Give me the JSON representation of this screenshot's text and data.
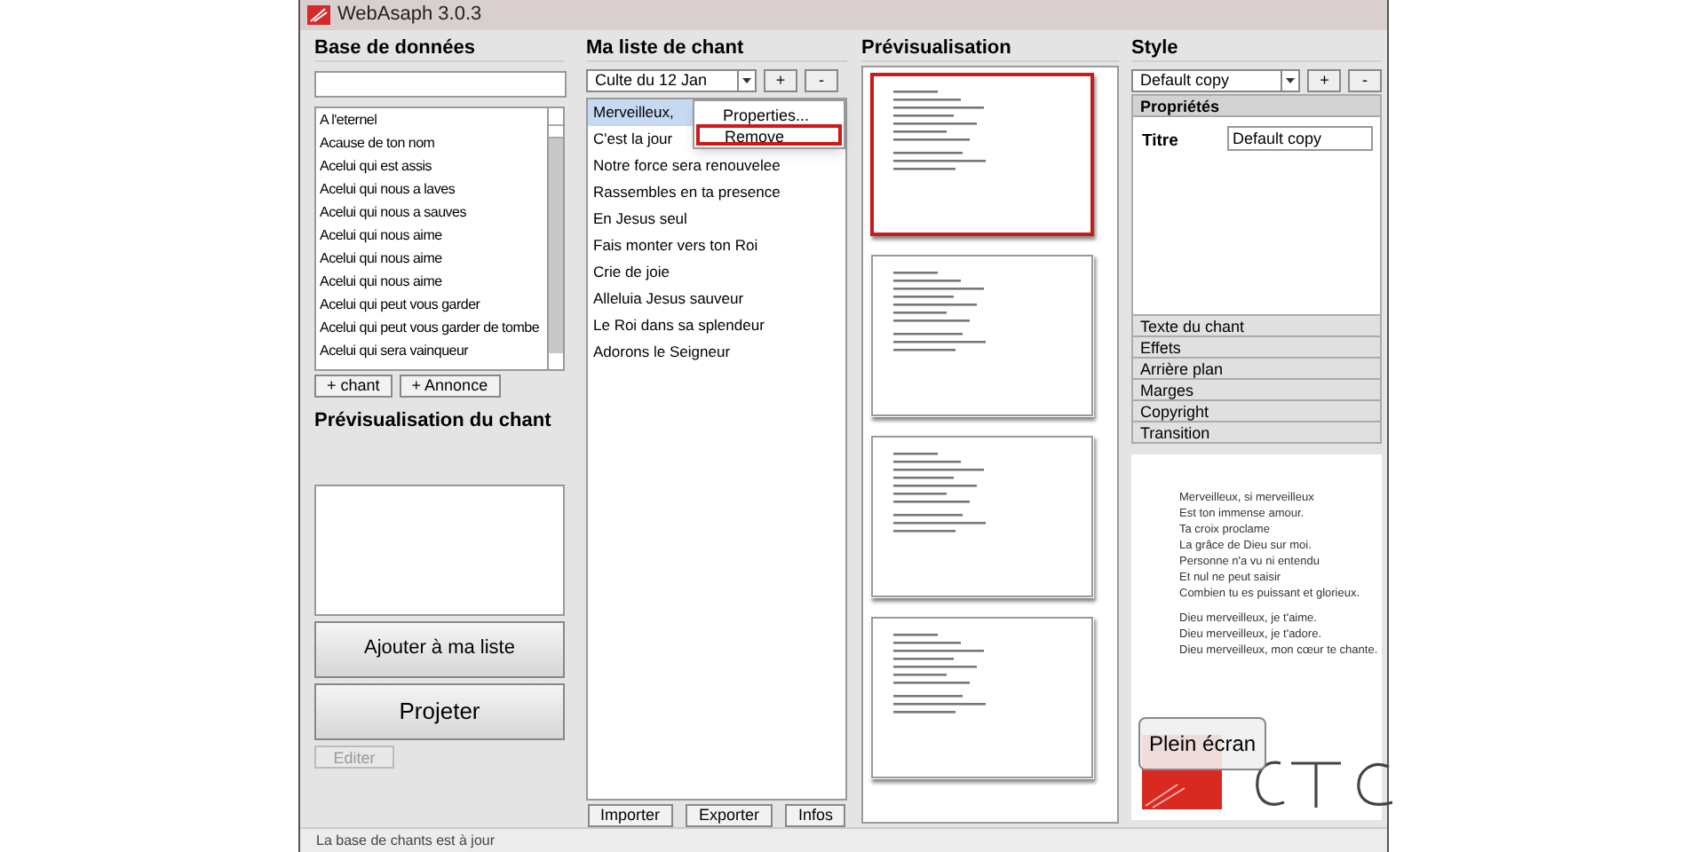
{
  "window": {
    "title": "WebAsaph 3.0.3"
  },
  "database": {
    "heading": "Base de données",
    "songs": [
      "A l'eternel",
      "Acause de ton nom",
      "Acelui qui est assis",
      "Acelui qui nous a laves",
      "Acelui qui nous a sauves",
      "Acelui qui nous aime",
      "Acelui qui nous aime",
      "Acelui qui nous aime",
      "Acelui qui peut vous garder",
      "Acelui qui peut vous garder de tombe",
      "Acelui qui sera vainqueur"
    ],
    "buttons": [
      "+ chant",
      "+ Annonce"
    ]
  },
  "song_preview": {
    "heading": "Prévisualisation du chant",
    "add_button": "Ajouter à ma liste",
    "project_button": "Projeter",
    "edit_button": {
      "label": "Editer",
      "disabled": true
    }
  },
  "my_list": {
    "heading": "Ma liste de chant",
    "playlist": "Culte du 12 Jan",
    "add": "+",
    "remove": "-",
    "items": [
      {
        "title": "Merveilleux,",
        "selected": true
      },
      {
        "title": "C'est la jour",
        "selected": false
      },
      {
        "title": "Notre force sera renouvelee",
        "selected": false
      },
      {
        "title": "Rassembles en ta presence",
        "selected": false
      },
      {
        "title": "En Jesus seul",
        "selected": false
      },
      {
        "title": "Fais monter vers ton Roi",
        "selected": false
      },
      {
        "title": "Crie de joie",
        "selected": false
      },
      {
        "title": "Alleluia Jesus sauveur",
        "selected": false
      },
      {
        "title": "Le Roi dans sa splendeur",
        "selected": false
      },
      {
        "title": "Adorons le Seigneur",
        "selected": false
      }
    ],
    "context_menu": [
      {
        "label": "Properties...",
        "highlighted": false
      },
      {
        "label": "Remove",
        "highlighted": true
      }
    ],
    "buttons": [
      "Importer",
      "Exporter",
      "Infos"
    ]
  },
  "preview": {
    "heading": "Prévisualisation",
    "slides": [
      {
        "selected": true
      },
      {
        "selected": false
      },
      {
        "selected": false
      },
      {
        "selected": false
      }
    ]
  },
  "style": {
    "heading": "Style",
    "style_name": "Default copy",
    "add": "+",
    "remove": "-",
    "sections": [
      {
        "title": "Propriétés",
        "expanded": true
      },
      {
        "title": "Texte du chant",
        "expanded": false
      },
      {
        "title": "Effets",
        "expanded": false
      },
      {
        "title": "Arrière plan",
        "expanded": false
      },
      {
        "title": "Marges",
        "expanded": false
      },
      {
        "title": "Copyright",
        "expanded": false
      },
      {
        "title": "Transition",
        "expanded": false
      }
    ],
    "title_label": "Titre",
    "title_value": "Default copy",
    "lyrics": [
      [
        "Merveilleux, si merveilleux",
        "Est ton immense amour.",
        "Ta croix proclame",
        "La grâce de Dieu sur moi.",
        "Personne n'a vu ni entendu",
        "Et nul ne peut saisir",
        "Combien tu es puissant et glorieux."
      ],
      [
        "Dieu merveilleux, je t'aime.",
        "Dieu merveilleux, je t'adore.",
        "Dieu merveilleux, mon cœur te chante."
      ]
    ],
    "fullscreen_button": "Plein écran"
  },
  "status_bar": "La base de chants est à jour"
}
